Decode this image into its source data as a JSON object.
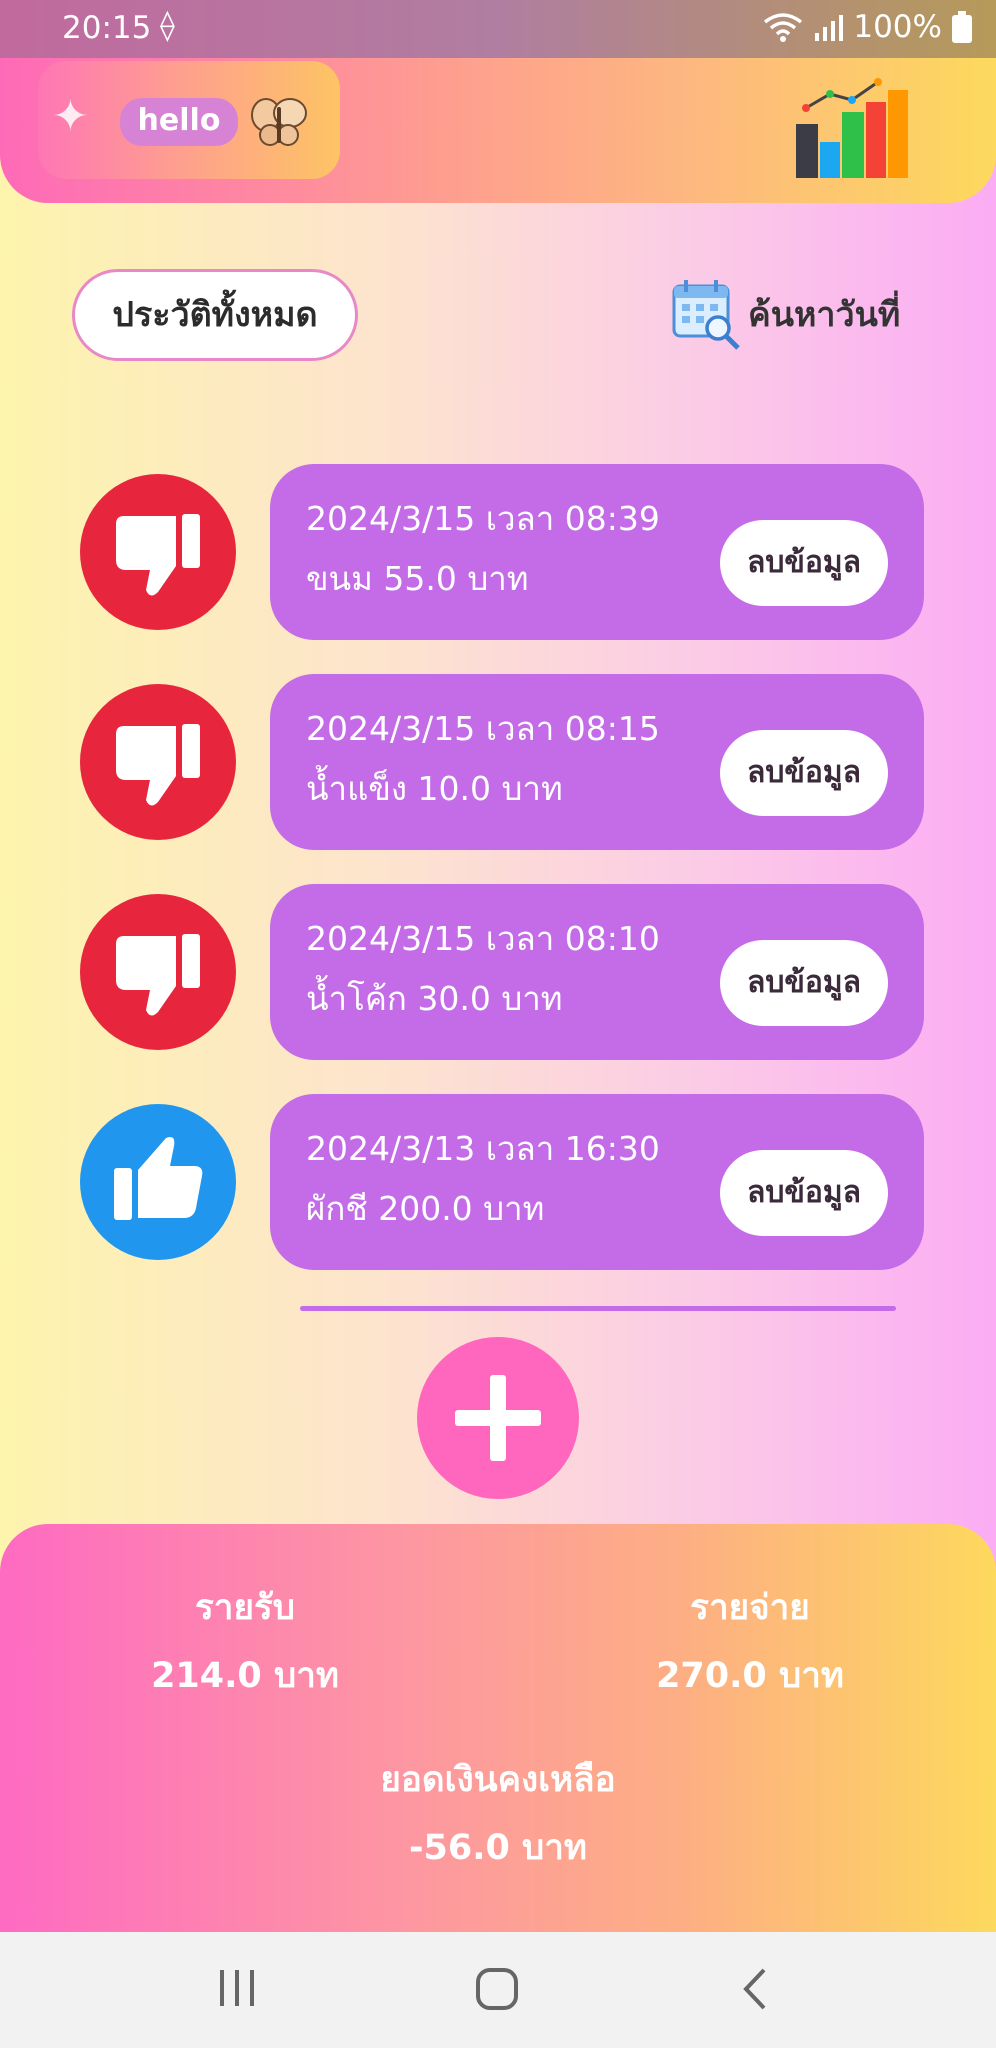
{
  "status_bar": {
    "time": "20:15",
    "battery": "100%"
  },
  "header": {
    "logo_text": "hello",
    "chart_icon": "bar-chart-icon"
  },
  "toolbar": {
    "history_label": "ประวัติทั้งหมด",
    "search_date_label": "ค้นหาวันที่"
  },
  "transactions": [
    {
      "datetime": "2024/3/15 เวลา 08:39",
      "description": "ขนม 55.0 บาท",
      "type": "expense",
      "icon": "thumbs-down-icon",
      "delete_label": "ลบข้อมูล"
    },
    {
      "datetime": "2024/3/15 เวลา 08:15",
      "description": "น้ำแข็ง 10.0 บาท",
      "type": "expense",
      "icon": "thumbs-down-icon",
      "delete_label": "ลบข้อมูล"
    },
    {
      "datetime": "2024/3/15 เวลา 08:10",
      "description": "น้ำโค้ก 30.0 บาท",
      "type": "expense",
      "icon": "thumbs-down-icon",
      "delete_label": "ลบข้อมูล"
    },
    {
      "datetime": "2024/3/13 เวลา 16:30",
      "description": "ผักชี 200.0 บาท",
      "type": "income",
      "icon": "thumbs-up-icon",
      "delete_label": "ลบข้อมูล"
    }
  ],
  "summary": {
    "income_label": "รายรับ",
    "income_value": "214.0 บาท",
    "expense_label": "รายจ่าย",
    "expense_value": "270.0 บาท",
    "balance_label": "ยอดเงินคงเหลือ",
    "balance_value": "-56.0 บาท"
  },
  "colors": {
    "card": "#c46be8",
    "expense": "#e7263e",
    "income": "#2196ee",
    "add_button": "#fe67bd"
  }
}
